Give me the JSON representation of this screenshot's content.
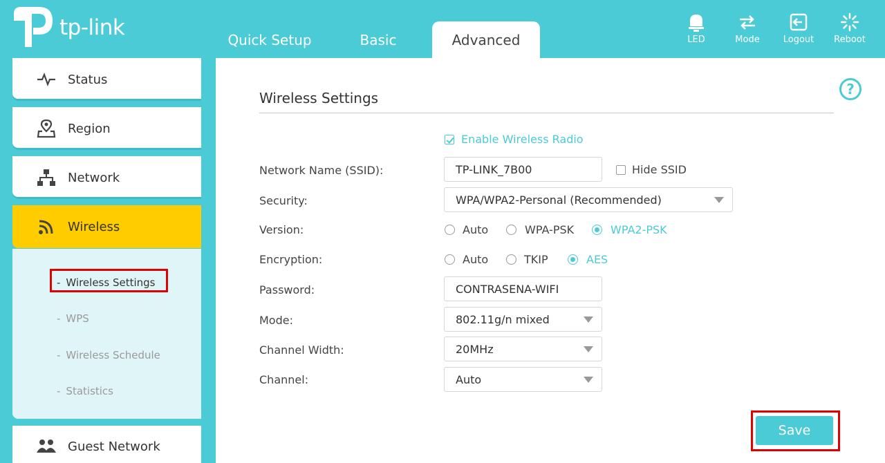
{
  "brand": {
    "name": "tp-link"
  },
  "tabs": [
    {
      "label": "Quick Setup"
    },
    {
      "label": "Basic"
    },
    {
      "label": "Advanced"
    }
  ],
  "top_icons": [
    {
      "label": "LED",
      "icon": "bulb-icon"
    },
    {
      "label": "Mode",
      "icon": "mode-icon"
    },
    {
      "label": "Logout",
      "icon": "logout-icon"
    },
    {
      "label": "Reboot",
      "icon": "reboot-icon"
    }
  ],
  "sidebar": {
    "items": [
      {
        "label": "Status",
        "icon": "pulse-icon"
      },
      {
        "label": "Region",
        "icon": "location-icon"
      },
      {
        "label": "Network",
        "icon": "network-icon"
      },
      {
        "label": "Wireless",
        "icon": "wifi-icon"
      },
      {
        "label": "Guest Network",
        "icon": "guests-icon"
      }
    ],
    "submenu": [
      {
        "label": "Wireless Settings"
      },
      {
        "label": "WPS"
      },
      {
        "label": "Wireless Schedule"
      },
      {
        "label": "Statistics"
      }
    ],
    "dash": "-"
  },
  "main": {
    "title": "Wireless Settings",
    "help": "?",
    "enable_radio_label": "Enable Wireless Radio",
    "labels": {
      "ssid": "Network Name (SSID):",
      "security": "Security:",
      "version": "Version:",
      "encryption": "Encryption:",
      "password": "Password:",
      "mode": "Mode:",
      "channel_width": "Channel Width:",
      "channel": "Channel:"
    },
    "values": {
      "ssid": "TP-LINK_7B00",
      "hide_ssid": "Hide SSID",
      "security": "WPA/WPA2-Personal (Recommended)",
      "password": "CONTRASENA-WIFI",
      "mode": "802.11g/n mixed",
      "channel_width": "20MHz",
      "channel": "Auto"
    },
    "version_options": [
      "Auto",
      "WPA-PSK",
      "WPA2-PSK"
    ],
    "version_selected": "WPA2-PSK",
    "encryption_options": [
      "Auto",
      "TKIP",
      "AES"
    ],
    "encryption_selected": "AES",
    "save_label": "Save"
  },
  "colors": {
    "accent": "#4acbd6",
    "active_nav": "#ffcc00",
    "highlight_box": "#e00000"
  }
}
